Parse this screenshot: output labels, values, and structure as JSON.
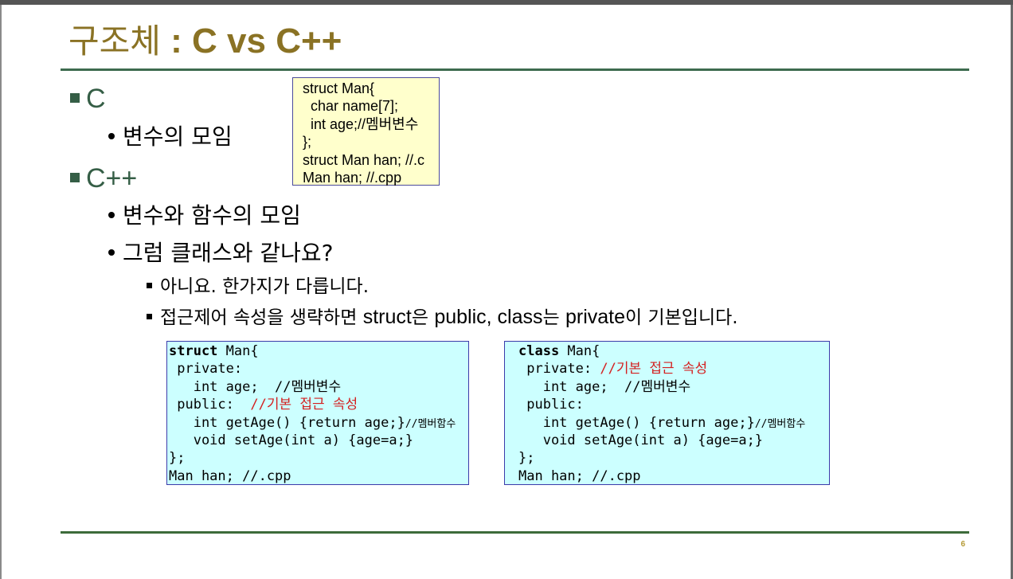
{
  "slide": {
    "title_korean": "구조체",
    "title_rest": " : C vs C++",
    "page_number": "6"
  },
  "bullets": {
    "c_heading": "C",
    "c_sub1": "변수의 모임",
    "cpp_heading": "C++",
    "cpp_sub1": "변수와 함수의 모임",
    "cpp_sub2": "그럼 클래스와 같나요?",
    "cpp_sub2_a": "아니요. 한가지가 다릅니다.",
    "cpp_sub2_b_1": "접근제어 속성을 생략하면 ",
    "cpp_sub2_b_2": "struct",
    "cpp_sub2_b_3": "은 ",
    "cpp_sub2_b_4": "public, class",
    "cpp_sub2_b_5": "는 ",
    "cpp_sub2_b_6": "private",
    "cpp_sub2_b_7": "이 기본입니다."
  },
  "c_code_box": {
    "lines": [
      "struct Man{",
      "  char name[7];",
      "  int age;//멤버변수",
      "};",
      "struct Man han; //.c",
      "Man han; //.cpp"
    ]
  },
  "struct_code_box": {
    "l1_kw": "struct",
    "l1_rest": " Man{",
    "l2": " private:",
    "l3": "   int age;  //멤버변수",
    "l4_a": " public:  ",
    "l4_cmt": "//기본 접근 속성",
    "l5_a": "   int getAge() {return age;}",
    "l5_small": "//멤버함수",
    "l6": "   void setAge(int a) {age=a;}",
    "l7": "};",
    "l8": "Man han; //.cpp"
  },
  "class_code_box": {
    "l1_kw": "class",
    "l1_rest": " Man{",
    "l2_a": " private: ",
    "l2_cmt": "//기본 접근 속성",
    "l3": "   int age;  //멤버변수",
    "l4": " public:",
    "l5_a": "   int getAge() {return age;}",
    "l5_small": "//멤버함수",
    "l6": "   void setAge(int a) {age=a;}",
    "l7": "};",
    "l8": "Man han; //.cpp"
  },
  "colors": {
    "title": "#8a7224",
    "heading_green": "#355e46",
    "rule_green": "#3d6b4f",
    "comment_red": "#d42020",
    "c_box_bg": "#ffffcc",
    "code_box_bg": "#ccffff"
  }
}
